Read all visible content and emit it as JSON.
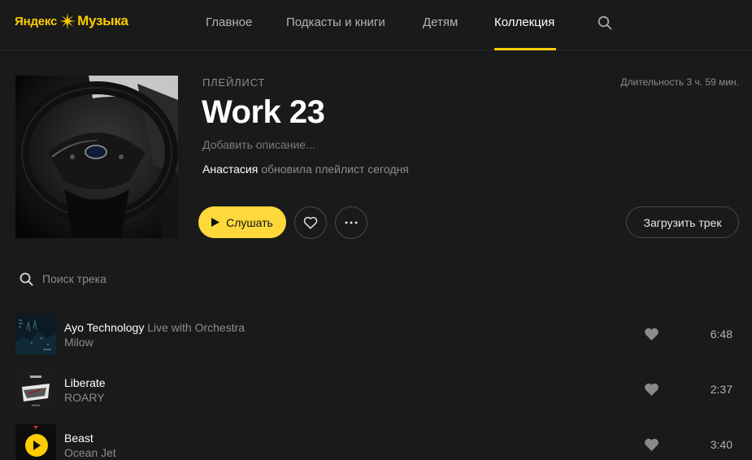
{
  "header": {
    "logo_yandex": "Яндекс",
    "logo_music": "Музыка",
    "nav": [
      {
        "label": "Главное",
        "active": false
      },
      {
        "label": "Подкасты и книги",
        "active": false
      },
      {
        "label": "Детям",
        "active": false
      },
      {
        "label": "Коллекция",
        "active": true
      }
    ],
    "search_icon": "search-icon"
  },
  "playlist": {
    "kind": "ПЛЕЙЛИСТ",
    "title": "Work 23",
    "description_placeholder": "Добавить описание...",
    "updated_user": "Анастасия",
    "updated_text": " обновила плейлист сегодня",
    "duration": "Длительность 3 ч. 59 мин.",
    "play_label": "Слушать",
    "upload_label": "Загрузить трек"
  },
  "track_search": {
    "placeholder": "Поиск трека"
  },
  "tracks": [
    {
      "title": "Ayo Technology",
      "version": "Live with Orchestra",
      "artist": "Milow",
      "duration": "6:48"
    },
    {
      "title": "Liberate",
      "version": "",
      "artist": "ROARY",
      "duration": "2:37"
    },
    {
      "title": "Beast",
      "version": "",
      "artist": "Ocean Jet",
      "duration": "3:40"
    }
  ],
  "colors": {
    "accent": "#ffcc00",
    "play_button": "#ffd83b",
    "background": "#1a1a1a",
    "muted_text": "#8c8c8c"
  }
}
